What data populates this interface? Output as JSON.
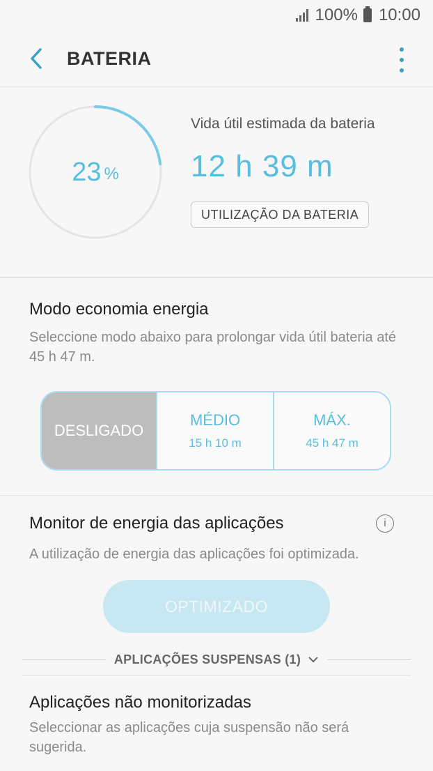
{
  "status_bar": {
    "signal_icon": "signal-icon",
    "battery_text": "100%",
    "battery_icon": "battery-icon",
    "time": "10:00"
  },
  "header": {
    "back_icon": "back-arrow-icon",
    "title": "BATERIA",
    "more_icon": "more-options-icon"
  },
  "battery": {
    "percent": "23",
    "percent_unit": "%",
    "percent_value": 0.23,
    "estimate_label": "Vida útil estimada da bateria",
    "estimate_time": "12 h 39 m",
    "usage_button": "UTILIZAÇÃO DA BATERIA"
  },
  "power_saving": {
    "title": "Modo economia energia",
    "description": "Seleccione modo abaixo para prolongar vida útil bateria até 45 h 47 m.",
    "modes": [
      {
        "label": "DESLIGADO",
        "sub": "",
        "selected": true
      },
      {
        "label": "MÉDIO",
        "sub": "15 h 10 m",
        "selected": false
      },
      {
        "label": "MÁX.",
        "sub": "45 h 47 m",
        "selected": false
      }
    ]
  },
  "app_monitor": {
    "title": "Monitor de energia das aplicações",
    "info_icon": "info-icon",
    "description": "A utilização de energia das aplicações foi optimizada.",
    "button": "OPTIMIZADO",
    "suspended_label": "APLICAÇÕES SUSPENSAS (1)",
    "suspended_icon": "chevron-down-icon"
  },
  "unmonitored": {
    "title": "Aplicações não monitorizadas",
    "description": "Seleccionar as aplicações cuja suspensão não será sugerida."
  },
  "colors": {
    "accent": "#59bde0",
    "accent_light": "#a9dcee",
    "button_disabled": "#c7e7f2",
    "mode_off": "#bdbdbd"
  }
}
